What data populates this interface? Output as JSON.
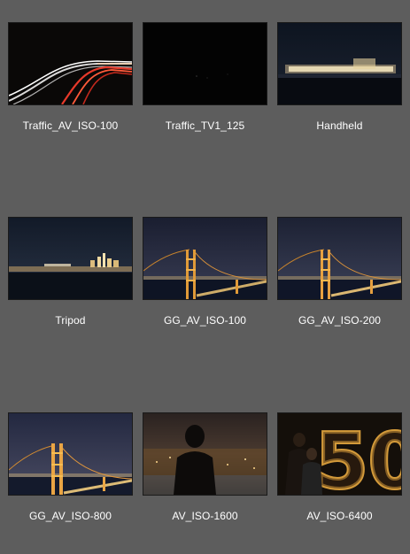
{
  "photos": [
    {
      "caption": "Traffic_AV_ISO-100",
      "scene": "traffic-trails"
    },
    {
      "caption": "Traffic_TV1_125",
      "scene": "dark"
    },
    {
      "caption": "Handheld",
      "scene": "city-blur"
    },
    {
      "caption": "Tripod",
      "scene": "city-skyline"
    },
    {
      "caption": "GG_AV_ISO-100",
      "scene": "golden-gate"
    },
    {
      "caption": "GG_AV_ISO-200",
      "scene": "golden-gate"
    },
    {
      "caption": "GG_AV_ISO-800",
      "scene": "golden-gate"
    },
    {
      "caption": "AV_ISO-1600",
      "scene": "silhouette"
    },
    {
      "caption": "AV_ISO-6400",
      "scene": "people-50"
    }
  ]
}
